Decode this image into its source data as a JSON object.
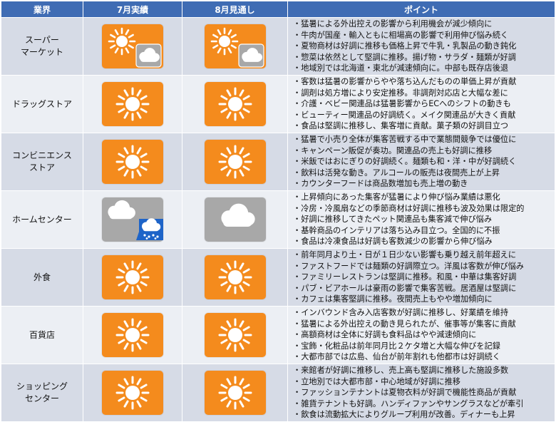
{
  "header": {
    "col_industry": "業界",
    "col_july": "7月実績",
    "col_august": "8月見通し",
    "col_points": "ポイント"
  },
  "colors": {
    "header_bg": "#3f6cb4",
    "sunny_bg": "#f48b1d",
    "cloudy_bg": "#a8a8a8",
    "rain_bg": "#1e64c8"
  },
  "rows": [
    {
      "industry_line1": "スーパー",
      "industry_line2": "マーケット",
      "july_icon": "sunny-with-cloud-icon",
      "august_icon": "sunny-with-cloud-icon",
      "points": [
        "・猛暑による外出控えの影響から利用機会が減少傾向に",
        "・牛肉が国産・輸入ともに相場高の影響で利用伸び悩み続く",
        "・夏物商材は好調に推移も価格上昇で牛乳・乳製品の動き鈍化",
        "・惣菜は依然として堅調に推移。揚げ物・サラダ・麺類が好調",
        "・地域別では北海道・東北が減速傾向に。中部も既存店後退"
      ]
    },
    {
      "industry_line1": "ドラッグストア",
      "industry_line2": "",
      "july_icon": "sunny-icon",
      "august_icon": "sunny-icon",
      "points": [
        "・客数は猛暑の影響からやや落ち込んだものの単価上昇が貢献",
        "・調剤は処方増により安定推移。非調剤対応店と大幅な差に",
        "・介護・ベビー関連品は猛暑影響からECへのシフトの動きも",
        "・ビューティー関連品の好調続く。メイク関連品が大きく貢献",
        "・食品は堅調に推移し、集客増に貢献。菓子類の好調目立つ"
      ]
    },
    {
      "industry_line1": "コンビニエンス",
      "industry_line2": "ストア",
      "july_icon": "sunny-icon",
      "august_icon": "sunny-icon",
      "points": [
        "・猛暑で小売り全体が集客苦戦する中で業態間競争では優位に",
        "・キャンペーン販促が奏功。関連品の売上も好調に推移",
        "・米飯ではおにぎりの好調続く。麺類も和・洋・中が好調続く",
        "・飲料は活発な動き。アルコールの販売は夜間売上が上昇",
        "・カウンターフードは商品数増加も売上増の動き"
      ]
    },
    {
      "industry_line1": "ホームセンター",
      "industry_line2": "",
      "july_icon": "cloudy-with-rain-icon",
      "august_icon": "cloudy-icon",
      "points": [
        "・上昇傾向にあった集客が猛暑により伸び悩み業績は悪化",
        "・冷房・冷風扇などの季節商材は好調に推移も波及効果は限定的",
        "・好調に推移してきたペット関連品も集客減で伸び悩み",
        "・基幹商品のインテリアは落ち込み目立つ。全国的に不振",
        "・食品は冷凍食品は好調も客数減少の影響から伸び悩み"
      ]
    },
    {
      "industry_line1": "外食",
      "industry_line2": "",
      "july_icon": "sunny-icon",
      "august_icon": "sunny-icon",
      "points": [
        "・前年同月より土・日が１日少ない影響も乗り越え前年超えに",
        "・ファストフードでは麺類の好調際立つ。洋風は客数が伸び悩み",
        "・ファミリーレストランは堅調に推移。和風・中華は集客好調",
        "・パブ・ビアホールは豪雨の影響で集客苦戦。居酒屋は堅調に",
        "・カフェは集客堅調に推移。夜間売上もやや増加傾向に"
      ]
    },
    {
      "industry_line1": "百貨店",
      "industry_line2": "",
      "july_icon": "sunny-icon",
      "august_icon": "sunny-icon",
      "points": [
        "・インバウンド含み入店客数が好調に推移し、好業績を維持",
        "・猛暑による外出控えの動き見られたが、催事等が集客に貢献",
        "・高額商材は全体に好調も食料品はやや減速傾向に",
        "・宝飾・化粧品は前年同月比２ケタ増と大幅な伸びを記録",
        "・大都市部では広島、仙台が前年割れも他都市は好調続く"
      ]
    },
    {
      "industry_line1": "ショッピング",
      "industry_line2": "センター",
      "july_icon": "sunny-icon",
      "august_icon": "sunny-icon",
      "points": [
        "・来館者が好調に推移し、売上高も堅調に推移した施設多数",
        "・立地別では大都市部・中心地域が好調に推移",
        "・ファッションテナントは夏物衣料が好調で機能性商品が貢献",
        "・雑貨テナントも好調。ハンディファンやサングラスなどが牽引",
        "・飲食は流動拡大によりグループ利用が改善。ディナーも上昇"
      ]
    }
  ]
}
